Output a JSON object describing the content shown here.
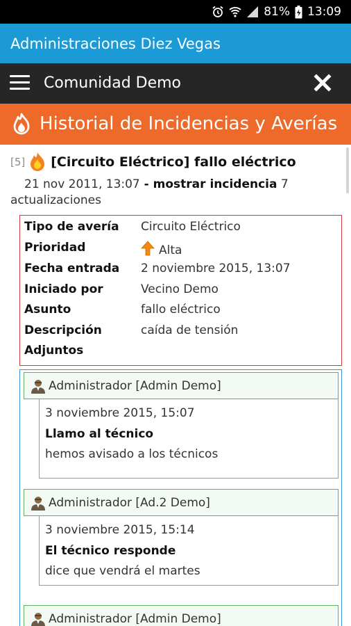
{
  "status_bar": {
    "battery": "81%",
    "time": "13:09"
  },
  "app": {
    "title": "Administraciones Diez Vegas"
  },
  "toolbar": {
    "community": "Comunidad Demo"
  },
  "section": {
    "title": "Historial de Incidencias y Averías"
  },
  "incident": {
    "number": "[5]",
    "title": "[Circuito Eléctrico] fallo eléctrico",
    "date": "21 nov 2011, 13:07",
    "separator": " - ",
    "show_link": "mostrar incidencia",
    "updates_count": " 7",
    "updates_label": "actualizaciones"
  },
  "details": [
    {
      "label": "Tipo de avería",
      "value": "Circuito Eléctrico"
    },
    {
      "label": "Prioridad",
      "value": "Alta"
    },
    {
      "label": "Fecha entrada",
      "value": "2 noviembre 2015, 13:07"
    },
    {
      "label": "Iniciado por",
      "value": "Vecino Demo"
    },
    {
      "label": "Asunto",
      "value": "fallo eléctrico"
    },
    {
      "label": "Descripción",
      "value": "caída de tensión"
    },
    {
      "label": "Adjuntos",
      "value": ""
    }
  ],
  "updates": [
    {
      "author": "Administrador [Admin Demo]",
      "date": "3 noviembre 2015, 15:07",
      "subject": "Llamo al técnico",
      "text": "hemos avisado a los técnicos"
    },
    {
      "author": "Administrador [Ad.2 Demo]",
      "date": "3 noviembre 2015, 15:14",
      "subject": "El técnico responde",
      "text": "dice que vendrá el martes"
    },
    {
      "author": "Administrador [Admin Demo]",
      "date": "",
      "subject": "",
      "text": ""
    }
  ],
  "colors": {
    "app_bar": "#1b9ad6",
    "toolbar": "#262626",
    "banner": "#ee6a2a",
    "details_border": "#d43a3a",
    "updates_border": "#3d8fd1",
    "update_header_border": "#5fb060"
  }
}
